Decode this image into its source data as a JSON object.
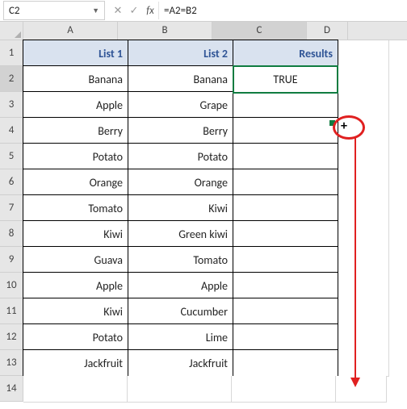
{
  "namebox": "C2",
  "formula": "=A2=B2",
  "columns": [
    "A",
    "B",
    "C",
    "D"
  ],
  "active_col": "C",
  "active_row": "2",
  "headers": {
    "a": "List 1",
    "b": "List 2",
    "c": "Results"
  },
  "rows": [
    {
      "n": "1"
    },
    {
      "n": "2",
      "a": "Banana",
      "b": "Banana",
      "c": "TRUE"
    },
    {
      "n": "3",
      "a": "Apple",
      "b": "Grape",
      "c": ""
    },
    {
      "n": "4",
      "a": "Berry",
      "b": "Berry",
      "c": ""
    },
    {
      "n": "5",
      "a": "Potato",
      "b": "Potato",
      "c": ""
    },
    {
      "n": "6",
      "a": "Orange",
      "b": "Orange",
      "c": ""
    },
    {
      "n": "7",
      "a": "Tomato",
      "b": "Kiwi",
      "c": ""
    },
    {
      "n": "8",
      "a": "Kiwi",
      "b": "Green kiwi",
      "c": ""
    },
    {
      "n": "9",
      "a": "Guava",
      "b": "Tomato",
      "c": ""
    },
    {
      "n": "10",
      "a": "Apple",
      "b": "Apple",
      "c": ""
    },
    {
      "n": "11",
      "a": "Kiwi",
      "b": "Cucumber",
      "c": ""
    },
    {
      "n": "12",
      "a": "Potato",
      "b": "Lime",
      "c": ""
    },
    {
      "n": "13",
      "a": "Jackfruit",
      "b": "Jackfruit",
      "c": ""
    },
    {
      "n": "14"
    }
  ],
  "chart_data": {
    "type": "table",
    "title": "Spreadsheet comparing two lists with formula =A2=B2",
    "columns": [
      "List 1",
      "List 2",
      "Results"
    ],
    "data": [
      [
        "Banana",
        "Banana",
        "TRUE"
      ],
      [
        "Apple",
        "Grape",
        ""
      ],
      [
        "Berry",
        "Berry",
        ""
      ],
      [
        "Potato",
        "Potato",
        ""
      ],
      [
        "Orange",
        "Orange",
        ""
      ],
      [
        "Tomato",
        "Kiwi",
        ""
      ],
      [
        "Kiwi",
        "Green kiwi",
        ""
      ],
      [
        "Guava",
        "Tomato",
        ""
      ],
      [
        "Apple",
        "Apple",
        ""
      ],
      [
        "Kiwi",
        "Cucumber",
        ""
      ],
      [
        "Potato",
        "Lime",
        ""
      ],
      [
        "Jackfruit",
        "Jackfruit",
        ""
      ]
    ]
  }
}
